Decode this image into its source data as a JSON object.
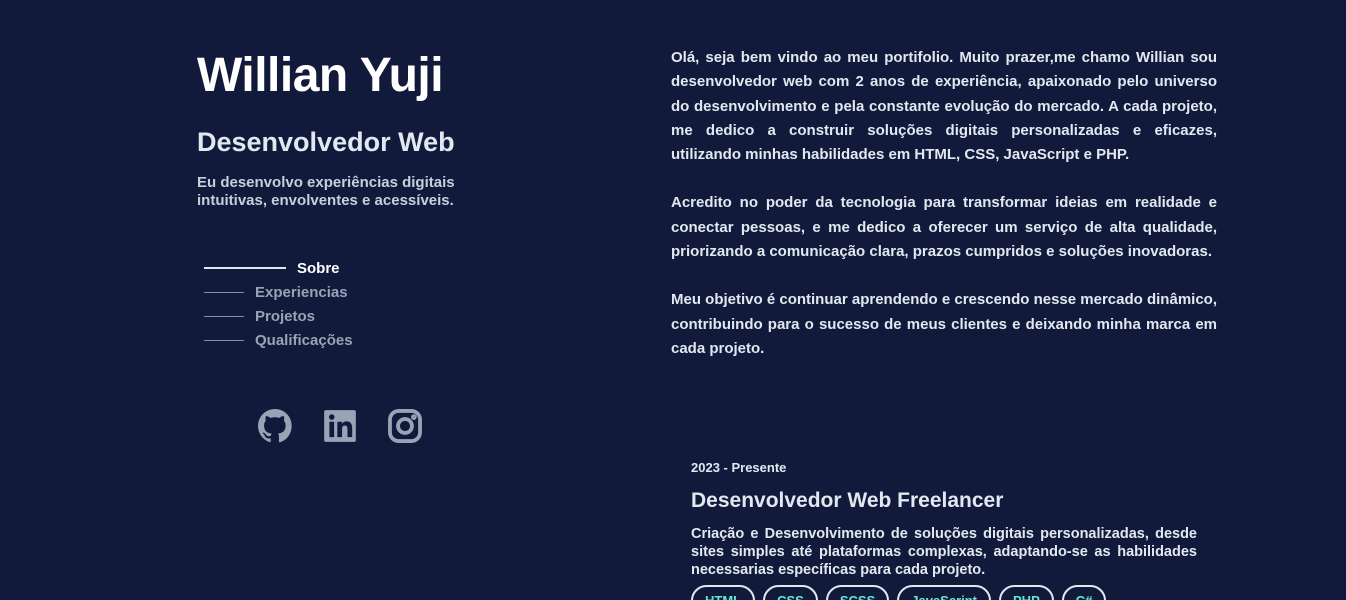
{
  "header": {
    "name": "Willian Yuji",
    "role": "Desenvolvedor Web",
    "tagline": "Eu desenvolvo experiências digitais intuitivas, envolventes e acessíveis."
  },
  "nav": {
    "items": [
      {
        "label": "Sobre",
        "active": true
      },
      {
        "label": "Experiencias",
        "active": false
      },
      {
        "label": "Projetos",
        "active": false
      },
      {
        "label": "Qualificações",
        "active": false
      }
    ]
  },
  "social": {
    "icons": [
      "github-icon",
      "linkedin-icon",
      "instagram-icon"
    ],
    "icon_color": "#9aa3b5"
  },
  "about": {
    "paragraphs": [
      "Olá, seja bem vindo ao meu portifolio. Muito prazer,me chamo Willian sou desenvolvedor web com 2 anos de experiência, apaixonado pelo universo do desenvolvimento e pela constante evolução do mercado. A cada projeto, me dedico a construir soluções digitais personalizadas e eficazes, utilizando minhas habilidades em HTML, CSS, JavaScript e PHP.",
      "Acredito no poder da tecnologia para transformar ideias em realidade e conectar pessoas, e me dedico a oferecer um serviço de alta qualidade, priorizando a comunicação clara, prazos cumpridos e soluções inovadoras.",
      "Meu objetivo é continuar aprendendo e crescendo nesse mercado dinâmico, contribuindo para o sucesso de meus clientes e deixando minha marca em cada projeto."
    ]
  },
  "experience": {
    "date": "2023 - Presente",
    "title": "Desenvolvedor Web Freelancer",
    "description": "Criação e Desenvolvimento de soluções digitais personalizadas, desde sites simples até plataformas complexas, adaptando-se as habilidades necessarias específicas para cada projeto.",
    "tags": [
      "HTML",
      "CSS",
      "SCSS",
      "JavaScript",
      "PHP",
      "C#"
    ]
  },
  "colors": {
    "background": "#121a3b",
    "text": "#e2e8f0",
    "accent": "#5eead4"
  }
}
